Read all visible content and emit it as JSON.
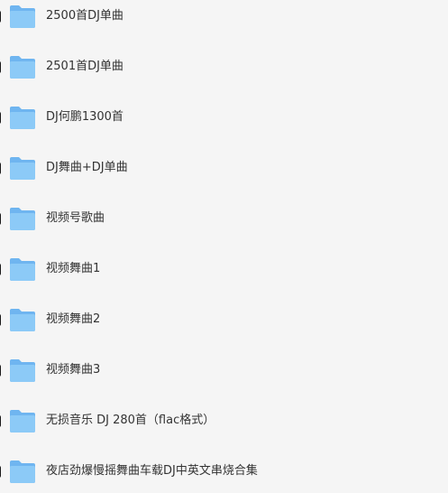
{
  "file_list": {
    "items": [
      {
        "name": "2500首DJ单曲",
        "icon": "folder-icon"
      },
      {
        "name": "2501首DJ单曲",
        "icon": "folder-icon"
      },
      {
        "name": "DJ何鹏1300首",
        "icon": "folder-icon"
      },
      {
        "name": "DJ舞曲+DJ单曲",
        "icon": "folder-icon"
      },
      {
        "name": "视频号歌曲",
        "icon": "folder-icon"
      },
      {
        "name": "视频舞曲1",
        "icon": "folder-icon"
      },
      {
        "name": "视频舞曲2",
        "icon": "folder-icon"
      },
      {
        "name": "视频舞曲3",
        "icon": "folder-icon"
      },
      {
        "name": "无损音乐 DJ 280首（flac格式）",
        "icon": "folder-icon"
      },
      {
        "name": "夜店劲爆慢摇舞曲车载DJ中英文串烧合集",
        "icon": "folder-icon"
      }
    ]
  },
  "colors": {
    "background": "#f5f5f5",
    "text": "#333333",
    "folder_back": "#6fb5f0",
    "folder_front": "#8ccaf7"
  }
}
